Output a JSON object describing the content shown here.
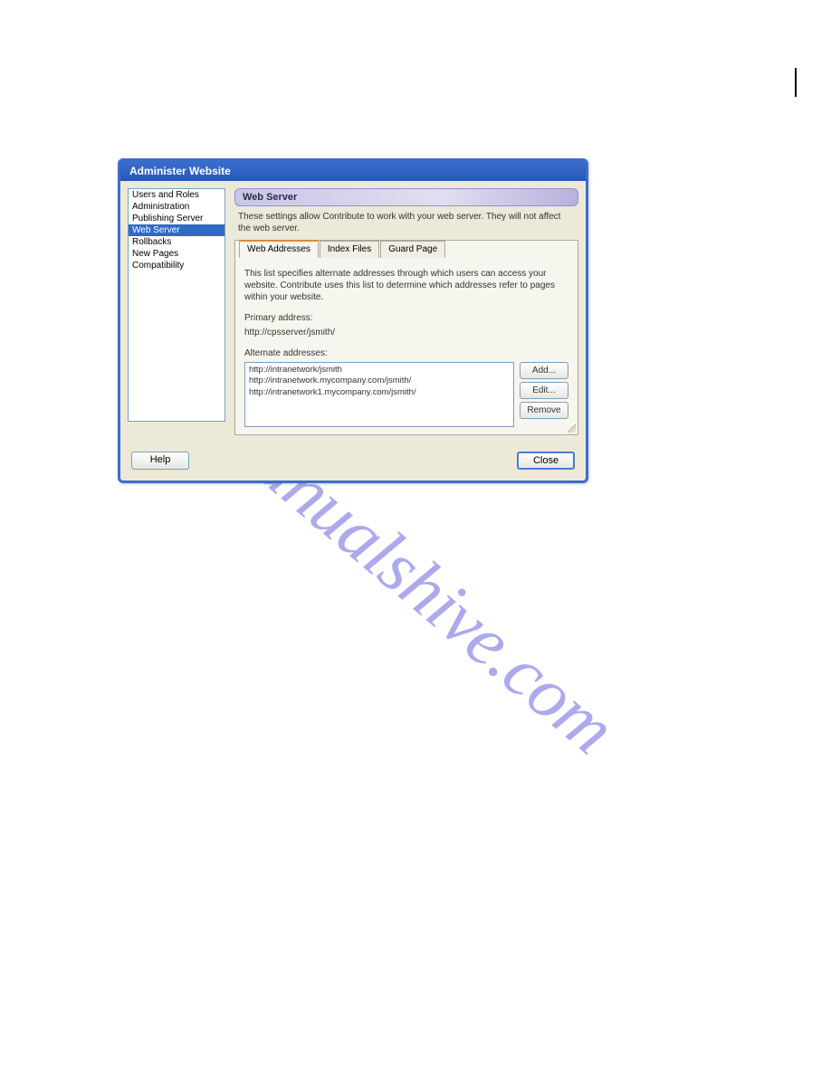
{
  "dialog": {
    "title": "Administer Website"
  },
  "sidebar": {
    "items": [
      {
        "label": "Users and Roles"
      },
      {
        "label": "Administration"
      },
      {
        "label": "Publishing Server"
      },
      {
        "label": "Web Server"
      },
      {
        "label": "Rollbacks"
      },
      {
        "label": "New Pages"
      },
      {
        "label": "Compatibility"
      }
    ],
    "selected_index": 3
  },
  "panel": {
    "header": "Web Server",
    "description": "These settings allow Contribute to work with your web server. They will not affect the web server."
  },
  "tabs": {
    "items": [
      {
        "label": "Web Addresses"
      },
      {
        "label": "Index Files"
      },
      {
        "label": "Guard Page"
      }
    ],
    "active_index": 0
  },
  "web_addresses": {
    "intro": "This list specifies alternate addresses through which users can access your website. Contribute uses this list to determine which addresses refer to pages within your website.",
    "primary_label": "Primary address:",
    "primary_value": "http://cpsserver/jsmith/",
    "alternate_label": "Alternate addresses:",
    "alternates": [
      "http://intranetwork/jsmith",
      "http://intranetwork.mycompany.com/jsmith/",
      "http://intranetwork1.mycompany.com/jsmith/"
    ],
    "buttons": {
      "add": "Add...",
      "edit": "Edit...",
      "remove": "Remove"
    }
  },
  "footer": {
    "help": "Help",
    "close": "Close"
  },
  "watermark": "manualshive.com"
}
